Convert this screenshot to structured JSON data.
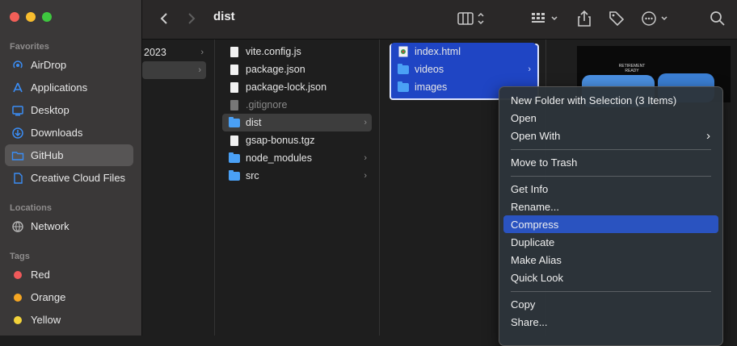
{
  "sidebar": {
    "favorites_heading": "Favorites",
    "locations_heading": "Locations",
    "tags_heading": "Tags",
    "favorites": [
      {
        "label": "AirDrop",
        "icon": "airdrop-icon"
      },
      {
        "label": "Applications",
        "icon": "applications-icon"
      },
      {
        "label": "Desktop",
        "icon": "desktop-icon"
      },
      {
        "label": "Downloads",
        "icon": "downloads-icon"
      },
      {
        "label": "GitHub",
        "icon": "folder-icon",
        "selected": true
      },
      {
        "label": "Creative Cloud Files",
        "icon": "document-icon"
      }
    ],
    "locations": [
      {
        "label": "Network",
        "icon": "network-icon"
      }
    ],
    "tags": [
      {
        "label": "Red",
        "color": "#f0595a"
      },
      {
        "label": "Orange",
        "color": "#f5a623"
      },
      {
        "label": "Yellow",
        "color": "#f3d33a"
      }
    ]
  },
  "toolbar": {
    "title": "dist"
  },
  "columns": {
    "first": {
      "items": [
        {
          "label": "2023"
        },
        {
          "label": ""
        }
      ]
    },
    "project": {
      "items": [
        {
          "label": "vite.config.js",
          "type": "file"
        },
        {
          "label": "package.json",
          "type": "file"
        },
        {
          "label": "package-lock.json",
          "type": "file"
        },
        {
          "label": ".gitignore",
          "type": "file-dim"
        },
        {
          "label": "dist",
          "type": "folder",
          "selected": true
        },
        {
          "label": "gsap-bonus.tgz",
          "type": "file"
        },
        {
          "label": "node_modules",
          "type": "folder"
        },
        {
          "label": "src",
          "type": "folder"
        }
      ]
    },
    "dist": {
      "items": [
        {
          "label": "index.html",
          "type": "html"
        },
        {
          "label": "videos",
          "type": "folder"
        },
        {
          "label": "images",
          "type": "folder"
        }
      ]
    }
  },
  "preview": {
    "text": "RETIREMENT READY"
  },
  "context_menu": {
    "items": [
      "New Folder with Selection (3 Items)",
      "Open",
      "Open With",
      "Move to Trash",
      "Get Info",
      "Rename...",
      "Compress",
      "Duplicate",
      "Make Alias",
      "Quick Look",
      "Copy",
      "Share..."
    ],
    "highlighted": "Compress"
  },
  "colors": {
    "accent": "#1f45c4",
    "highlight": "#2a53c0",
    "folder": "#4aa0f5"
  }
}
